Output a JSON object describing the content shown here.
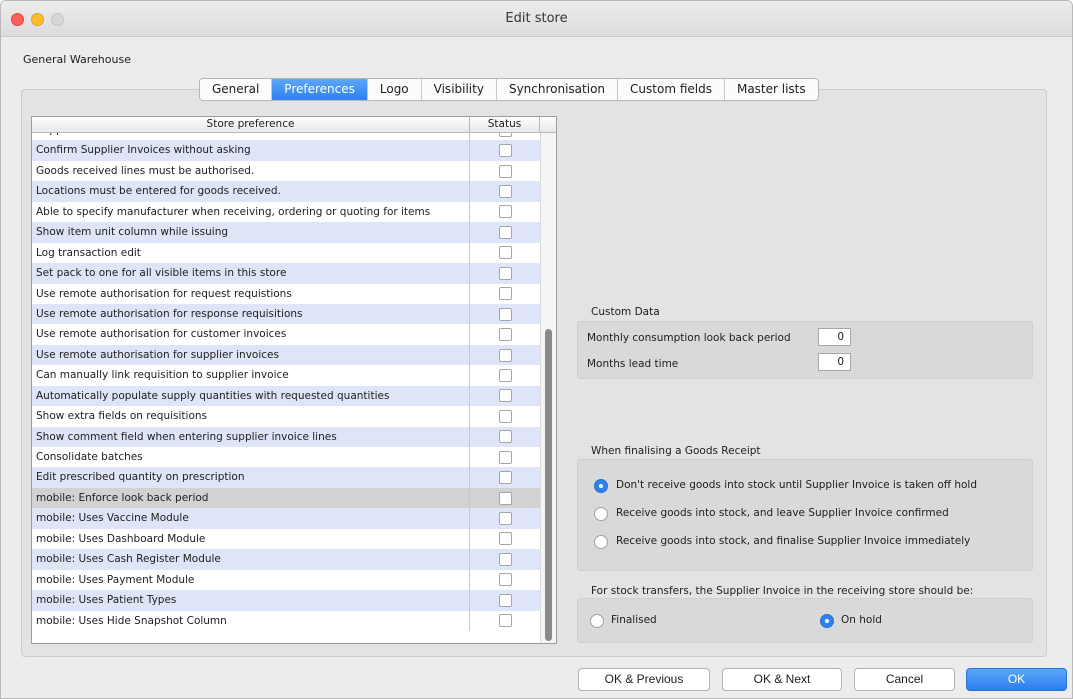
{
  "window": {
    "title": "Edit store"
  },
  "store": {
    "name": "General Warehouse"
  },
  "tabs": [
    {
      "label": "General"
    },
    {
      "label": "Preferences"
    },
    {
      "label": "Logo"
    },
    {
      "label": "Visibility"
    },
    {
      "label": "Synchronisation"
    },
    {
      "label": "Custom fields"
    },
    {
      "label": "Master lists"
    }
  ],
  "active_tab": "Preferences",
  "table": {
    "headers": {
      "preference": "Store preference",
      "status": "Status"
    },
    "rows": [
      {
        "label": "Supplier invoices must be authorised",
        "checked": false
      },
      {
        "label": "Confirm Supplier Invoices without asking",
        "checked": false
      },
      {
        "label": "Goods received lines must be authorised.",
        "checked": false
      },
      {
        "label": "Locations must be entered for goods received.",
        "checked": false
      },
      {
        "label": "Able to specify manufacturer when receiving, ordering or quoting for items",
        "checked": false
      },
      {
        "label": "Show item unit column while issuing",
        "checked": false
      },
      {
        "label": "Log transaction edit",
        "checked": false
      },
      {
        "label": "Set pack to one for all visible items in this store",
        "checked": false
      },
      {
        "label": "Use remote authorisation for request requistions",
        "checked": false
      },
      {
        "label": "Use remote authorisation for response requisitions",
        "checked": false
      },
      {
        "label": "Use remote authorisation for customer invoices",
        "checked": false
      },
      {
        "label": "Use remote authorisation for supplier invoices",
        "checked": false
      },
      {
        "label": "Can manually link requisition to supplier invoice",
        "checked": false
      },
      {
        "label": "Automatically populate supply quantities with requested quantities",
        "checked": false
      },
      {
        "label": "Show extra fields on requisitions",
        "checked": false
      },
      {
        "label": "Show comment field when entering supplier invoice lines",
        "checked": false
      },
      {
        "label": "Consolidate batches",
        "checked": false
      },
      {
        "label": "Edit prescribed quantity on prescription",
        "checked": false
      },
      {
        "label": "mobile: Enforce look back period",
        "checked": false,
        "selected": true
      },
      {
        "label": "mobile: Uses Vaccine Module",
        "checked": false
      },
      {
        "label": "mobile: Uses Dashboard Module",
        "checked": false
      },
      {
        "label": "mobile: Uses Cash Register Module",
        "checked": false
      },
      {
        "label": "mobile: Uses Payment Module",
        "checked": false
      },
      {
        "label": "mobile: Uses Patient Types",
        "checked": false
      },
      {
        "label": "mobile: Uses Hide Snapshot Column",
        "checked": false
      }
    ]
  },
  "custom_data": {
    "title": "Custom Data",
    "monthly_label": "Monthly consumption look back period",
    "monthly_value": "0",
    "lead_label": "Months lead time",
    "lead_value": "0"
  },
  "goods_receipt": {
    "title": "When finalising a Goods Receipt",
    "options": [
      {
        "label": "Don't receive goods into stock until Supplier Invoice is taken off hold",
        "selected": true
      },
      {
        "label": "Receive goods into stock, and leave Supplier Invoice confirmed",
        "selected": false
      },
      {
        "label": "Receive goods into stock, and finalise Supplier Invoice immediately",
        "selected": false
      }
    ]
  },
  "stock_transfers": {
    "title": "For stock transfers, the Supplier Invoice in the receiving store should be:",
    "options": [
      {
        "label": "Finalised",
        "selected": false
      },
      {
        "label": "On hold",
        "selected": true
      }
    ]
  },
  "buttons": {
    "ok_previous": "OK & Previous",
    "ok_next": "OK & Next",
    "cancel": "Cancel",
    "ok": "OK"
  },
  "colors": {
    "accent": "#2f7fed",
    "row_alt": "#dfe5f8"
  }
}
